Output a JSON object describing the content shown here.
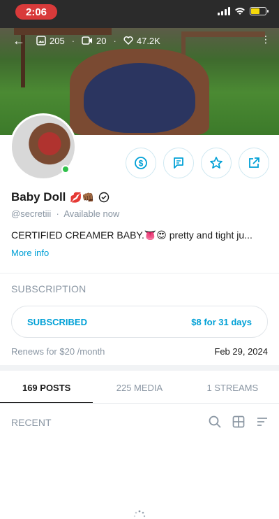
{
  "status_bar": {
    "time": "2:06"
  },
  "cover": {
    "posts_count": "205",
    "videos_count": "20",
    "likes_count": "47.2K"
  },
  "profile": {
    "name": "Baby Doll",
    "name_emojis": "💋👊🏾",
    "handle": "@secretiii",
    "availability": "Available now",
    "bio": "CERTIFIED CREAMER BABY.👅😍 pretty and tight ju...",
    "more_info": "More info"
  },
  "subscription": {
    "section_title": "SUBSCRIPTION",
    "status_label": "SUBSCRIBED",
    "price_label": "$8 for 31 days",
    "renew_label": "Renews for $20 /month",
    "renew_date": "Feb 29, 2024"
  },
  "tabs": [
    {
      "label": "169 POSTS",
      "active": true
    },
    {
      "label": "225 MEDIA",
      "active": false
    },
    {
      "label": "1 STREAMS",
      "active": false
    }
  ],
  "feed": {
    "section_title": "RECENT"
  },
  "colors": {
    "accent": "#00a0d6",
    "time_pill": "#d93a3a",
    "online": "#2fc04a"
  }
}
